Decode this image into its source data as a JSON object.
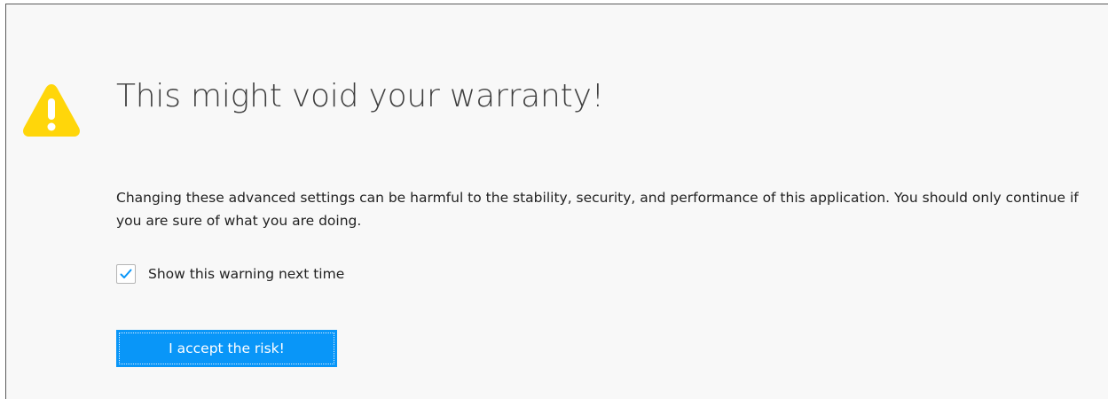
{
  "warning": {
    "icon": "warning-triangle-icon",
    "title": "This might void your warranty!",
    "description": "Changing these advanced settings can be harmful to the stability, security, and performance of this application. You should only continue if you are sure of what you are doing."
  },
  "checkbox": {
    "label": "Show this warning next time",
    "checked": true
  },
  "button": {
    "label": "I accept the risk!"
  },
  "colors": {
    "background": "#f8f8f8",
    "accent": "#0996f8",
    "warning": "#ffd60a",
    "text": "#222222",
    "title": "#3e3e3e"
  }
}
